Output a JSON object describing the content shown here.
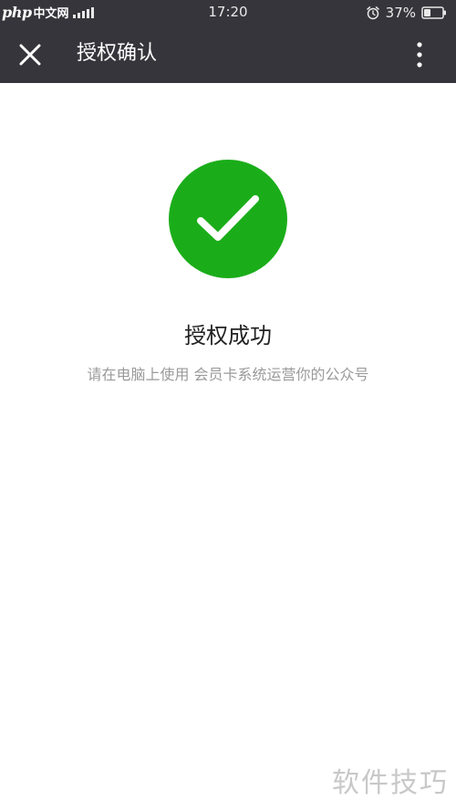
{
  "status_bar": {
    "site_logo": "php",
    "site_label": "中文网",
    "time": "17:20",
    "battery_percent": "37%",
    "battery_level": 0.37,
    "icons": [
      "signal-icon",
      "alarm-icon",
      "battery-icon"
    ]
  },
  "header": {
    "title": "授权确认",
    "close_icon": "close-icon",
    "more_icon": "more-vertical-icon"
  },
  "result": {
    "icon": "checkmark-icon",
    "title": "授权成功",
    "description": "请在电脑上使用 会员卡系统运营你的公众号"
  },
  "watermark": "软件技巧",
  "colors": {
    "bar_background": "#35353b",
    "success_green": "#1aad19",
    "title_text": "#222222",
    "desc_text": "#9a9a9a",
    "watermark_text": "#c8c8c8"
  }
}
